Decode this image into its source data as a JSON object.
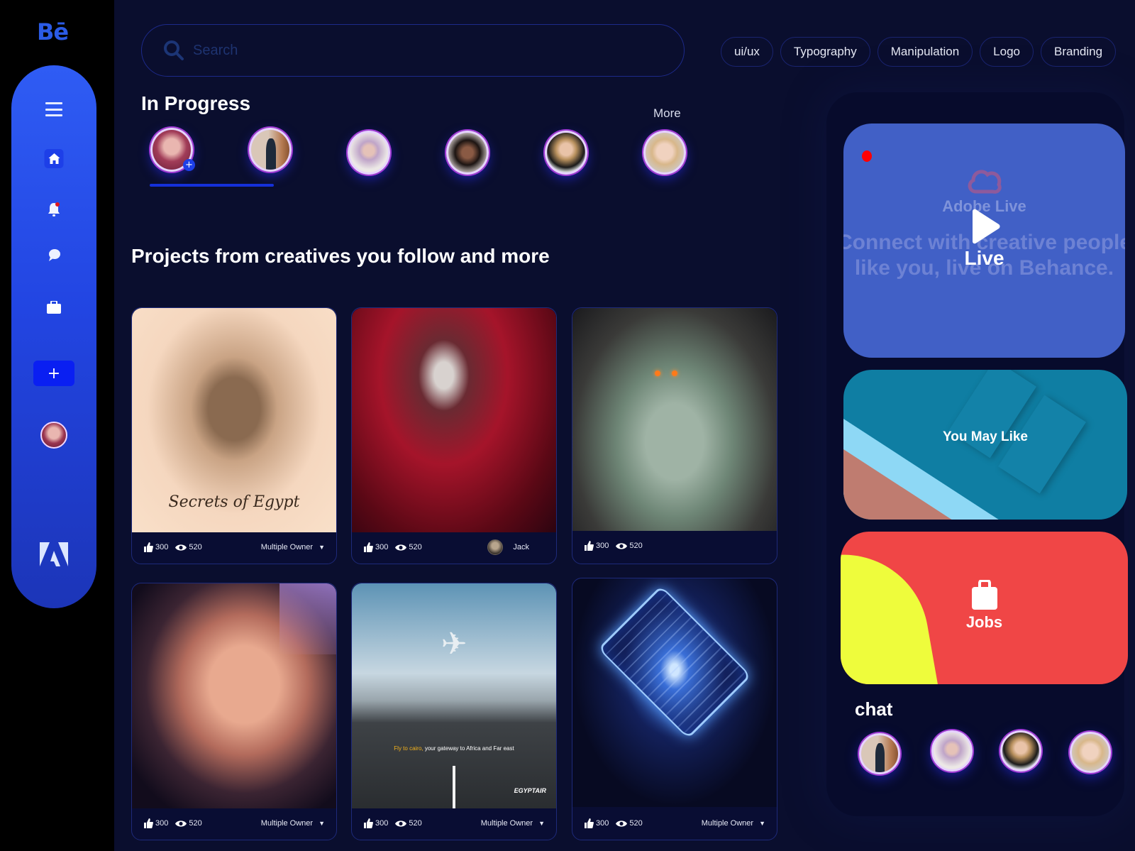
{
  "app": {
    "logo": "Bē"
  },
  "sidebar": {
    "items": [
      {
        "name": "menu",
        "icon": "hamburger-icon"
      },
      {
        "name": "home",
        "icon": "home-icon",
        "active": true
      },
      {
        "name": "notifications",
        "icon": "bell-icon",
        "badge": true
      },
      {
        "name": "messages",
        "icon": "chat-bubble-icon"
      },
      {
        "name": "jobs",
        "icon": "briefcase-icon"
      },
      {
        "name": "create",
        "icon": "plus-icon",
        "label": "+"
      },
      {
        "name": "profile",
        "icon": "avatar"
      },
      {
        "name": "adobe",
        "icon": "adobe-logo-icon"
      }
    ]
  },
  "search": {
    "placeholder": "Search",
    "value": ""
  },
  "tags": [
    "ui/ux",
    "Typography",
    "Manipulation",
    "Logo",
    "Branding"
  ],
  "in_progress": {
    "title": "In Progress",
    "more_label": "More",
    "stories": [
      {
        "name": "current-user",
        "has_add": true,
        "add_label": "+"
      },
      {
        "name": "man-in-suit"
      },
      {
        "name": "lilac-hair-woman"
      },
      {
        "name": "curly-hair-woman"
      },
      {
        "name": "blonde-woman"
      },
      {
        "name": "fair-hair-woman"
      }
    ],
    "progress": 0.23
  },
  "projects": {
    "title": "Projects from creatives you follow and more",
    "cards": [
      {
        "art": "Secrets of Egypt",
        "art_text": "Secrets of Egypt",
        "likes": "300",
        "views": "520",
        "owner": "Multiple Owner",
        "owner_type": "dropdown"
      },
      {
        "art": "red rosary portrait",
        "likes": "300",
        "views": "520",
        "owner": "Jack",
        "owner_type": "user"
      },
      {
        "art": "horned woman with serpents",
        "likes": "300",
        "views": "520",
        "owner": "",
        "owner_type": "none"
      },
      {
        "art": "woman with lace light",
        "likes": "300",
        "views": "520",
        "owner": "Multiple Owner",
        "owner_type": "dropdown"
      },
      {
        "art": "EgyptAir runway ad",
        "art_caption_highlight": "Fly to cairo,",
        "art_caption": " your gateway to Africa and Far east",
        "art_brand": "EGYPTAIR",
        "likes": "300",
        "views": "520",
        "owner": "Multiple Owner",
        "owner_type": "dropdown"
      },
      {
        "art": "glowing maze cube",
        "likes": "300",
        "views": "520",
        "owner": "Multiple Owner",
        "owner_type": "dropdown"
      }
    ]
  },
  "right_panel": {
    "live": {
      "brand": "Adobe Live",
      "background_text_1": "Connect with creative people",
      "background_text_2": "like you, live on Behance.",
      "label": "Live",
      "recording_indicator": true
    },
    "you_may_like": {
      "label": "You May Like"
    },
    "jobs": {
      "label": "Jobs"
    },
    "chat": {
      "title": "chat",
      "contacts": [
        {
          "name": "man-in-suit"
        },
        {
          "name": "lilac-hair-woman"
        },
        {
          "name": "blonde-woman"
        },
        {
          "name": "fair-hair-woman"
        }
      ]
    }
  },
  "colors": {
    "background": "#0a0e2e",
    "sidebar_accent": "#2f5cf4",
    "logo": "#2b5be6",
    "live_card": "#4160c6",
    "jobs_red": "#f04646",
    "jobs_yellow": "#eefc3c",
    "you_may_like_teal": "#0f7ea3",
    "notification_dot": "#ff0000"
  }
}
